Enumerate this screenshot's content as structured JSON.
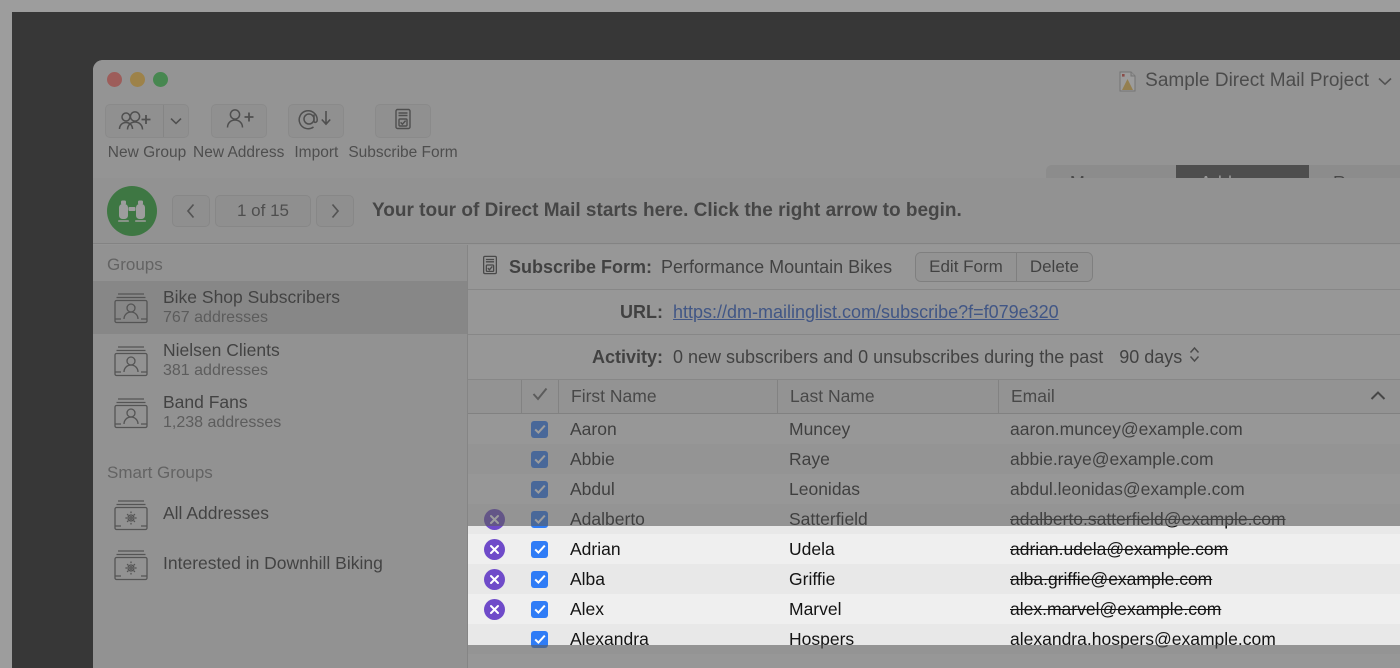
{
  "window": {
    "title": "Sample Direct Mail Project",
    "title_icon": "document-icon",
    "title_chevron": "chevron-down-icon",
    "traffic_lights": [
      "close-button",
      "minimize-button",
      "zoom-button"
    ]
  },
  "toolbar": {
    "items": [
      {
        "label": "New Group",
        "icon": "new-group-icon",
        "has_dropdown": true,
        "dropdown_icon": "chevron-down-icon"
      },
      {
        "label": "New Address",
        "icon": "new-address-icon",
        "has_dropdown": false
      },
      {
        "label": "Import",
        "icon": "import-at-icon",
        "has_dropdown": false
      },
      {
        "label": "Subscribe Form",
        "icon": "subscribe-form-icon",
        "has_dropdown": false
      }
    ]
  },
  "tabs": {
    "items": [
      {
        "label": "Messages",
        "active": false
      },
      {
        "label": "Addresses",
        "active": true
      },
      {
        "label": "Repor",
        "active": false
      }
    ]
  },
  "tour": {
    "icon": "binoculars-icon",
    "prev_icon": "chevron-left-icon",
    "next_icon": "chevron-right-icon",
    "counter": "1 of 15",
    "message": "Your tour of Direct Mail starts here. Click the right arrow to begin."
  },
  "sidebar": {
    "groups_header": "Groups",
    "groups": [
      {
        "name": "Bike Shop Subscribers",
        "count": "767 addresses",
        "selected": true,
        "icon": "group-card-icon"
      },
      {
        "name": "Nielsen Clients",
        "count": "381 addresses",
        "selected": false,
        "icon": "group-card-icon"
      },
      {
        "name": "Band Fans",
        "count": "1,238 addresses",
        "selected": false,
        "icon": "group-card-icon"
      }
    ],
    "smart_groups_header": "Smart Groups",
    "smart_groups": [
      {
        "name": "All Addresses",
        "icon": "smart-group-gear-icon"
      },
      {
        "name": "Interested in Downhill Biking",
        "icon": "smart-group-gear-icon"
      }
    ]
  },
  "subscribe_form": {
    "icon": "subscribe-form-icon",
    "label": "Subscribe Form:",
    "name": "Performance Mountain Bikes",
    "edit_button": "Edit Form",
    "delete_button": "Delete",
    "url_label": "URL:",
    "url": "https://dm-mailinglist.com/subscribe?f=f079e320",
    "activity_label": "Activity:",
    "activity_text": "0 new subscribers and 0 unsubscribes during the past",
    "activity_period": "90 days",
    "activity_period_icon": "up-down-chevrons-icon"
  },
  "table": {
    "header_check_icon": "checkmark-icon",
    "columns": [
      "First Name",
      "Last Name",
      "Email"
    ],
    "sort_icon": "caret-up-icon",
    "rows": [
      {
        "error": false,
        "checked": true,
        "first": "Aaron",
        "last": "Muncey",
        "email": "aaron.muncey@example.com",
        "struck": false,
        "selected": false
      },
      {
        "error": false,
        "checked": true,
        "first": "Abbie",
        "last": "Raye",
        "email": "abbie.raye@example.com",
        "struck": false,
        "selected": false
      },
      {
        "error": false,
        "checked": true,
        "first": "Abdul",
        "last": "Leonidas",
        "email": "abdul.leonidas@example.com",
        "struck": false,
        "selected": false
      },
      {
        "error": true,
        "checked": true,
        "first": "Adalberto",
        "last": "Satterfield",
        "email": "adalberto.satterfield@example.com",
        "struck": true,
        "selected": false
      },
      {
        "error": true,
        "checked": true,
        "first": "Adrian",
        "last": "Udela",
        "email": "adrian.udela@example.com",
        "struck": true,
        "selected": false
      },
      {
        "error": true,
        "checked": true,
        "first": "Alba",
        "last": "Griffie",
        "email": "alba.griffie@example.com",
        "struck": true,
        "selected": false
      },
      {
        "error": true,
        "checked": true,
        "first": "Alex",
        "last": "Marvel",
        "email": "alex.marvel@example.com",
        "struck": true,
        "selected": false
      },
      {
        "error": false,
        "checked": true,
        "first": "Alexandra",
        "last": "Hospers",
        "email": "alexandra.hospers@example.com",
        "struck": false,
        "selected": false
      }
    ]
  },
  "colors": {
    "accent_checkbox": "#2f7cf6",
    "error_badge": "#6f4bc9",
    "link": "#1a4fc4",
    "tour_badge": "#12a01e",
    "active_tab_bg": "#3b3b3b"
  }
}
